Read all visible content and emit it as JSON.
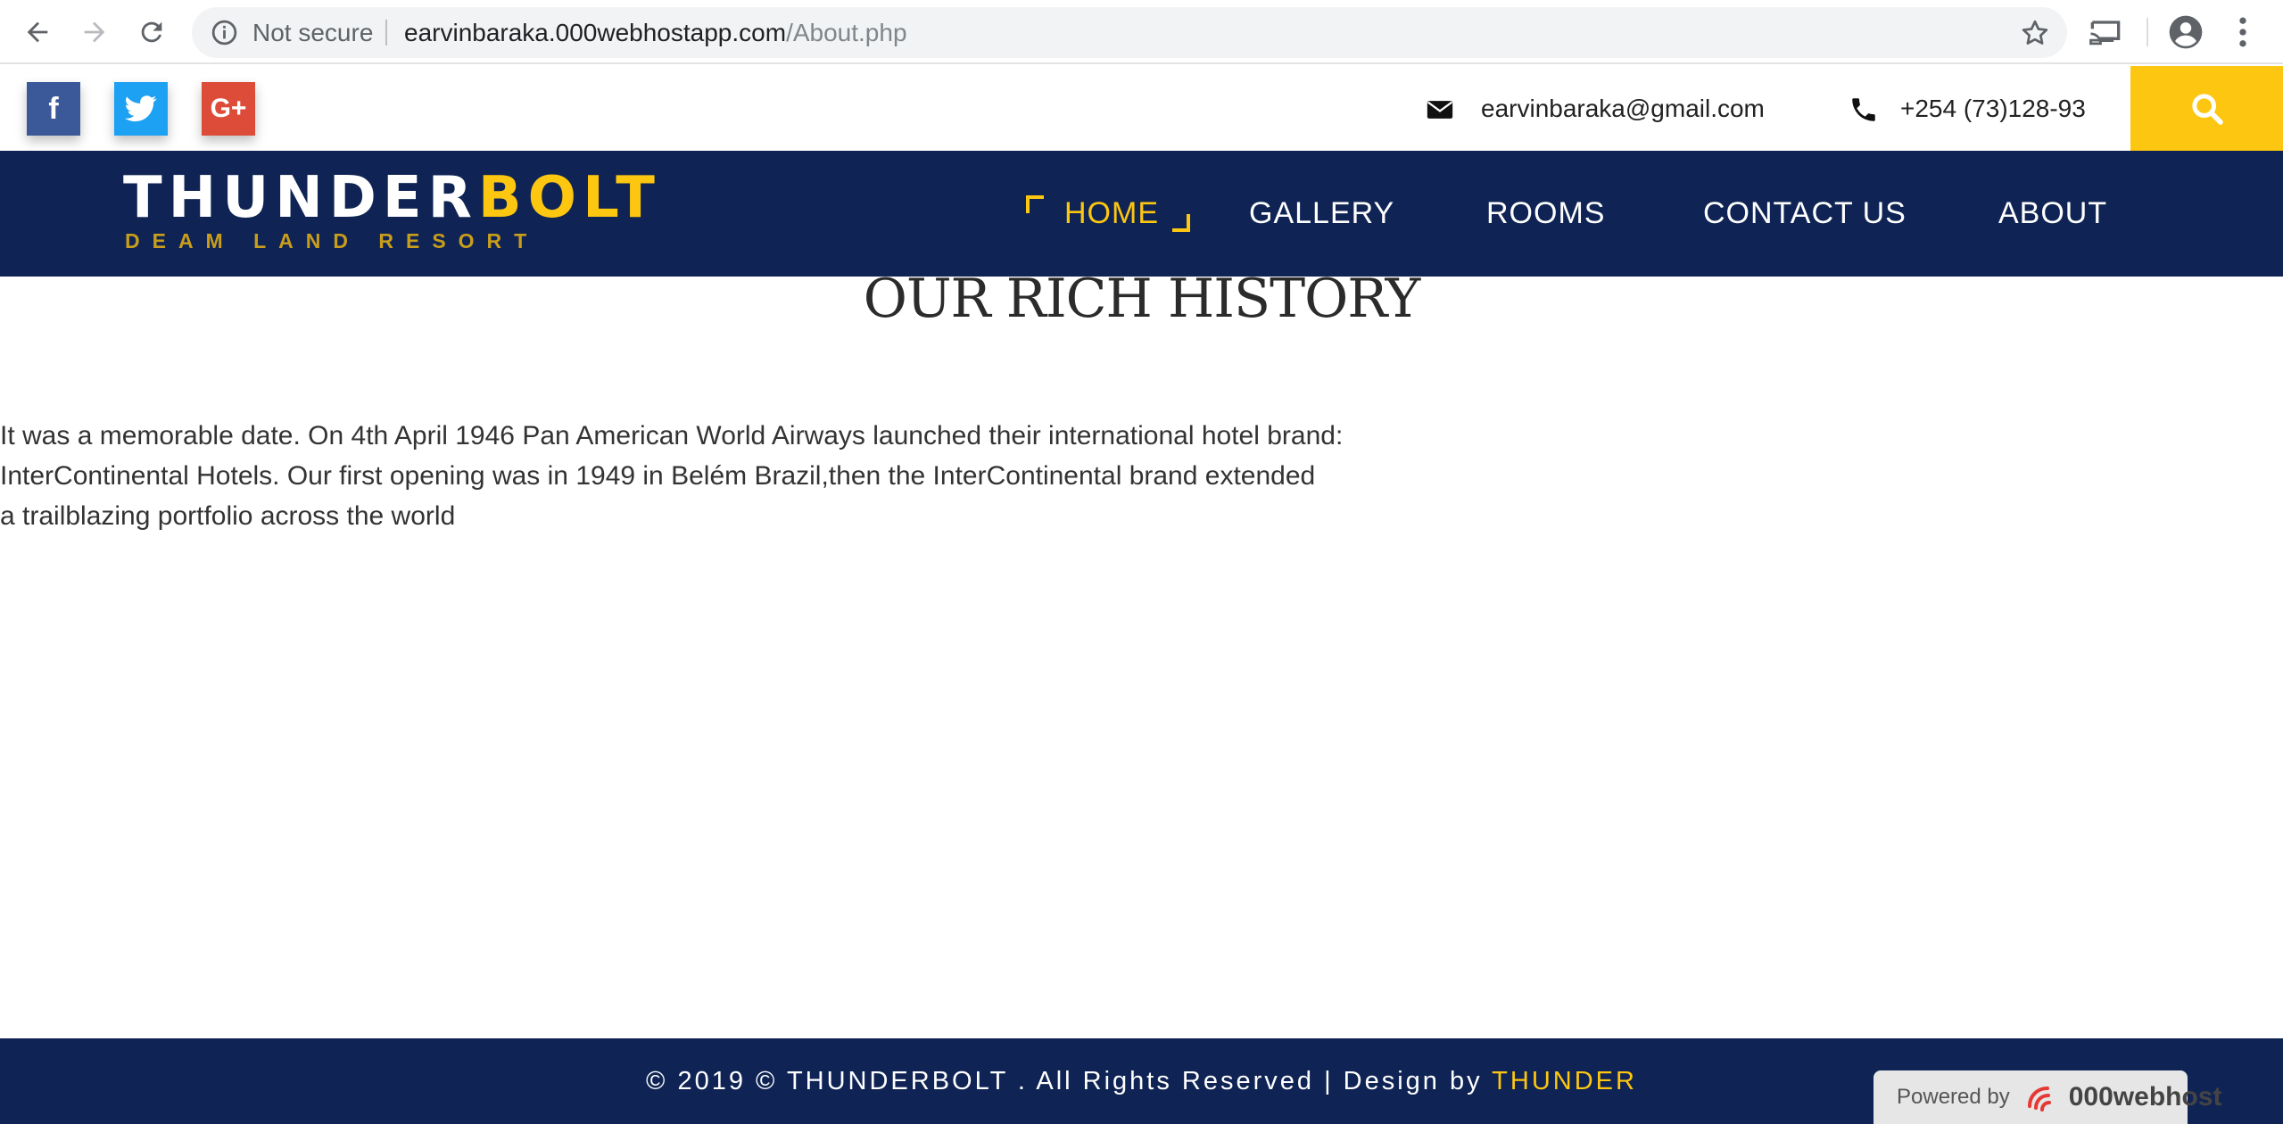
{
  "browser": {
    "security_text": "Not secure",
    "url_host": "earvinbaraka.000webhostapp.com",
    "url_path": "/About.php",
    "icons": [
      "back-icon",
      "forward-icon",
      "reload-icon",
      "info-icon",
      "star-icon",
      "cast-icon",
      "account-icon",
      "menu-icon"
    ]
  },
  "topbar": {
    "social": [
      {
        "name": "facebook",
        "glyph": "f",
        "color": "#3b5998"
      },
      {
        "name": "twitter",
        "glyph": "t",
        "color": "#1da1f2"
      },
      {
        "name": "google-plus",
        "glyph": "G+",
        "color": "#dd4b39"
      }
    ],
    "email": "earvinbaraka@gmail.com",
    "phone": "+254 (73)128-93",
    "search_color": "#fdc610"
  },
  "nav": {
    "logo_part1": "THUNDER",
    "logo_part2": "BOLT",
    "logo_sub": "DEAM LAND RESORT",
    "items": [
      "HOME",
      "GALLERY",
      "ROOMS",
      "CONTACT US",
      "ABOUT"
    ],
    "active": "HOME",
    "bg_color": "#0f2454",
    "accent_color": "#fdc610"
  },
  "content": {
    "heading": "OUR RICH HISTORY",
    "paragraph_lines": [
      "It was a memorable date. On 4th April 1946 Pan American World Airways launched their international hotel brand:",
      "InterContinental Hotels. Our first opening was in 1949 in Belém Brazil,then the InterContinental brand extended",
      "a trailblazing portfolio across the world"
    ]
  },
  "footer": {
    "text_prefix": "© 2019 © THUNDERBOLT . All Rights Reserved | Design by ",
    "designer": "THUNDER",
    "badge_label": "Powered by",
    "badge_brand": "000webhost"
  }
}
